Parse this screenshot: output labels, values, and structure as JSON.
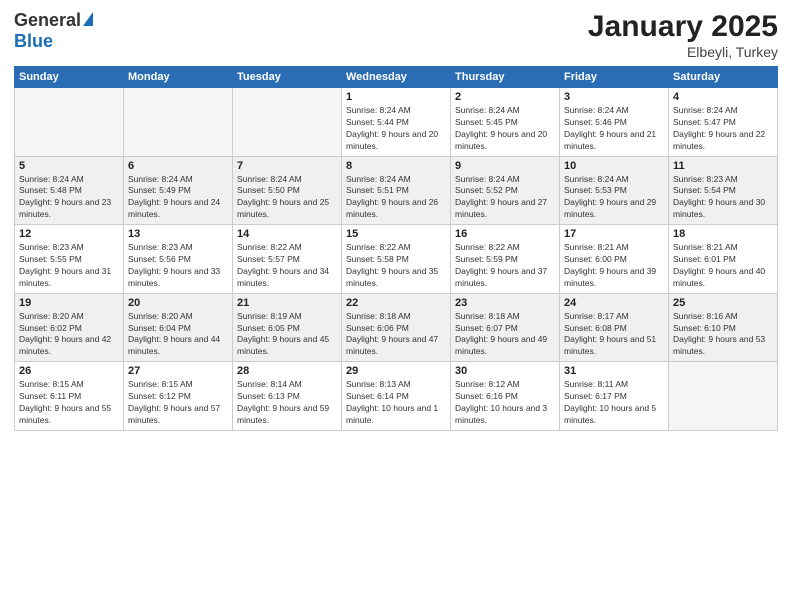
{
  "header": {
    "logo_general": "General",
    "logo_blue": "Blue",
    "month_title": "January 2025",
    "subtitle": "Elbeyli, Turkey"
  },
  "days_of_week": [
    "Sunday",
    "Monday",
    "Tuesday",
    "Wednesday",
    "Thursday",
    "Friday",
    "Saturday"
  ],
  "weeks": [
    {
      "shaded": false,
      "days": [
        {
          "number": "",
          "empty": true,
          "sunrise": "",
          "sunset": "",
          "daylight": ""
        },
        {
          "number": "",
          "empty": true,
          "sunrise": "",
          "sunset": "",
          "daylight": ""
        },
        {
          "number": "",
          "empty": true,
          "sunrise": "",
          "sunset": "",
          "daylight": ""
        },
        {
          "number": "1",
          "empty": false,
          "sunrise": "Sunrise: 8:24 AM",
          "sunset": "Sunset: 5:44 PM",
          "daylight": "Daylight: 9 hours and 20 minutes."
        },
        {
          "number": "2",
          "empty": false,
          "sunrise": "Sunrise: 8:24 AM",
          "sunset": "Sunset: 5:45 PM",
          "daylight": "Daylight: 9 hours and 20 minutes."
        },
        {
          "number": "3",
          "empty": false,
          "sunrise": "Sunrise: 8:24 AM",
          "sunset": "Sunset: 5:46 PM",
          "daylight": "Daylight: 9 hours and 21 minutes."
        },
        {
          "number": "4",
          "empty": false,
          "sunrise": "Sunrise: 8:24 AM",
          "sunset": "Sunset: 5:47 PM",
          "daylight": "Daylight: 9 hours and 22 minutes."
        }
      ]
    },
    {
      "shaded": true,
      "days": [
        {
          "number": "5",
          "empty": false,
          "sunrise": "Sunrise: 8:24 AM",
          "sunset": "Sunset: 5:48 PM",
          "daylight": "Daylight: 9 hours and 23 minutes."
        },
        {
          "number": "6",
          "empty": false,
          "sunrise": "Sunrise: 8:24 AM",
          "sunset": "Sunset: 5:49 PM",
          "daylight": "Daylight: 9 hours and 24 minutes."
        },
        {
          "number": "7",
          "empty": false,
          "sunrise": "Sunrise: 8:24 AM",
          "sunset": "Sunset: 5:50 PM",
          "daylight": "Daylight: 9 hours and 25 minutes."
        },
        {
          "number": "8",
          "empty": false,
          "sunrise": "Sunrise: 8:24 AM",
          "sunset": "Sunset: 5:51 PM",
          "daylight": "Daylight: 9 hours and 26 minutes."
        },
        {
          "number": "9",
          "empty": false,
          "sunrise": "Sunrise: 8:24 AM",
          "sunset": "Sunset: 5:52 PM",
          "daylight": "Daylight: 9 hours and 27 minutes."
        },
        {
          "number": "10",
          "empty": false,
          "sunrise": "Sunrise: 8:24 AM",
          "sunset": "Sunset: 5:53 PM",
          "daylight": "Daylight: 9 hours and 29 minutes."
        },
        {
          "number": "11",
          "empty": false,
          "sunrise": "Sunrise: 8:23 AM",
          "sunset": "Sunset: 5:54 PM",
          "daylight": "Daylight: 9 hours and 30 minutes."
        }
      ]
    },
    {
      "shaded": false,
      "days": [
        {
          "number": "12",
          "empty": false,
          "sunrise": "Sunrise: 8:23 AM",
          "sunset": "Sunset: 5:55 PM",
          "daylight": "Daylight: 9 hours and 31 minutes."
        },
        {
          "number": "13",
          "empty": false,
          "sunrise": "Sunrise: 8:23 AM",
          "sunset": "Sunset: 5:56 PM",
          "daylight": "Daylight: 9 hours and 33 minutes."
        },
        {
          "number": "14",
          "empty": false,
          "sunrise": "Sunrise: 8:22 AM",
          "sunset": "Sunset: 5:57 PM",
          "daylight": "Daylight: 9 hours and 34 minutes."
        },
        {
          "number": "15",
          "empty": false,
          "sunrise": "Sunrise: 8:22 AM",
          "sunset": "Sunset: 5:58 PM",
          "daylight": "Daylight: 9 hours and 35 minutes."
        },
        {
          "number": "16",
          "empty": false,
          "sunrise": "Sunrise: 8:22 AM",
          "sunset": "Sunset: 5:59 PM",
          "daylight": "Daylight: 9 hours and 37 minutes."
        },
        {
          "number": "17",
          "empty": false,
          "sunrise": "Sunrise: 8:21 AM",
          "sunset": "Sunset: 6:00 PM",
          "daylight": "Daylight: 9 hours and 39 minutes."
        },
        {
          "number": "18",
          "empty": false,
          "sunrise": "Sunrise: 8:21 AM",
          "sunset": "Sunset: 6:01 PM",
          "daylight": "Daylight: 9 hours and 40 minutes."
        }
      ]
    },
    {
      "shaded": true,
      "days": [
        {
          "number": "19",
          "empty": false,
          "sunrise": "Sunrise: 8:20 AM",
          "sunset": "Sunset: 6:02 PM",
          "daylight": "Daylight: 9 hours and 42 minutes."
        },
        {
          "number": "20",
          "empty": false,
          "sunrise": "Sunrise: 8:20 AM",
          "sunset": "Sunset: 6:04 PM",
          "daylight": "Daylight: 9 hours and 44 minutes."
        },
        {
          "number": "21",
          "empty": false,
          "sunrise": "Sunrise: 8:19 AM",
          "sunset": "Sunset: 6:05 PM",
          "daylight": "Daylight: 9 hours and 45 minutes."
        },
        {
          "number": "22",
          "empty": false,
          "sunrise": "Sunrise: 8:18 AM",
          "sunset": "Sunset: 6:06 PM",
          "daylight": "Daylight: 9 hours and 47 minutes."
        },
        {
          "number": "23",
          "empty": false,
          "sunrise": "Sunrise: 8:18 AM",
          "sunset": "Sunset: 6:07 PM",
          "daylight": "Daylight: 9 hours and 49 minutes."
        },
        {
          "number": "24",
          "empty": false,
          "sunrise": "Sunrise: 8:17 AM",
          "sunset": "Sunset: 6:08 PM",
          "daylight": "Daylight: 9 hours and 51 minutes."
        },
        {
          "number": "25",
          "empty": false,
          "sunrise": "Sunrise: 8:16 AM",
          "sunset": "Sunset: 6:10 PM",
          "daylight": "Daylight: 9 hours and 53 minutes."
        }
      ]
    },
    {
      "shaded": false,
      "days": [
        {
          "number": "26",
          "empty": false,
          "sunrise": "Sunrise: 8:15 AM",
          "sunset": "Sunset: 6:11 PM",
          "daylight": "Daylight: 9 hours and 55 minutes."
        },
        {
          "number": "27",
          "empty": false,
          "sunrise": "Sunrise: 8:15 AM",
          "sunset": "Sunset: 6:12 PM",
          "daylight": "Daylight: 9 hours and 57 minutes."
        },
        {
          "number": "28",
          "empty": false,
          "sunrise": "Sunrise: 8:14 AM",
          "sunset": "Sunset: 6:13 PM",
          "daylight": "Daylight: 9 hours and 59 minutes."
        },
        {
          "number": "29",
          "empty": false,
          "sunrise": "Sunrise: 8:13 AM",
          "sunset": "Sunset: 6:14 PM",
          "daylight": "Daylight: 10 hours and 1 minute."
        },
        {
          "number": "30",
          "empty": false,
          "sunrise": "Sunrise: 8:12 AM",
          "sunset": "Sunset: 6:16 PM",
          "daylight": "Daylight: 10 hours and 3 minutes."
        },
        {
          "number": "31",
          "empty": false,
          "sunrise": "Sunrise: 8:11 AM",
          "sunset": "Sunset: 6:17 PM",
          "daylight": "Daylight: 10 hours and 5 minutes."
        },
        {
          "number": "",
          "empty": true,
          "sunrise": "",
          "sunset": "",
          "daylight": ""
        }
      ]
    }
  ]
}
